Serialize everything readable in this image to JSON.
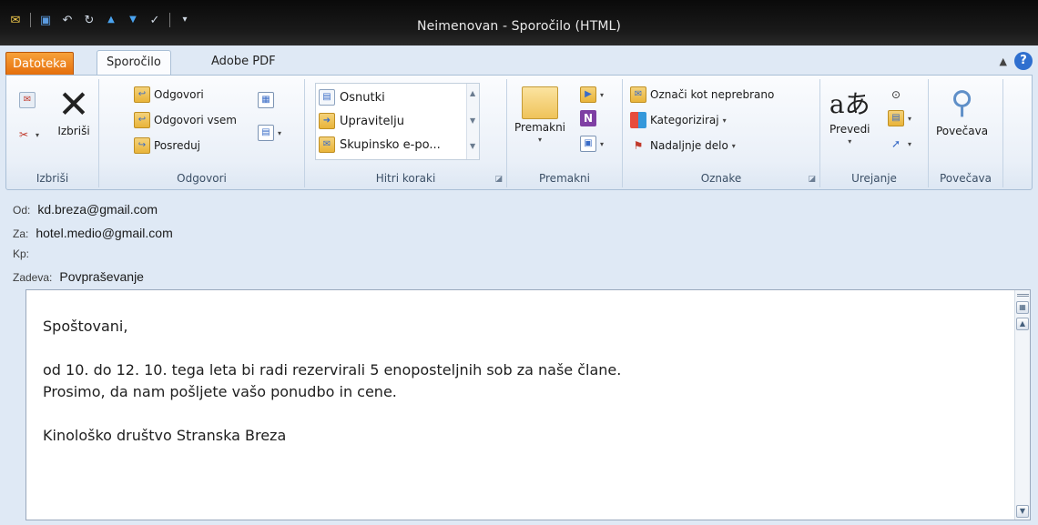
{
  "window": {
    "title": "Neimenovan  -  Sporočilo (HTML)"
  },
  "quick_access": [
    {
      "icon": "mail-icon",
      "glyph": "✉"
    },
    {
      "icon": "save-icon",
      "glyph": "■"
    },
    {
      "icon": "undo-icon",
      "glyph": "↶"
    },
    {
      "icon": "redo-icon",
      "glyph": "↻"
    },
    {
      "icon": "arrow-up-icon",
      "glyph": "▲"
    },
    {
      "icon": "arrow-down-icon",
      "glyph": "▼"
    },
    {
      "icon": "spelling-icon",
      "glyph": "✓"
    },
    {
      "icon": "customize-icon",
      "glyph": "▾"
    }
  ],
  "tabs": {
    "file": "Datoteka",
    "message": "Sporočilo",
    "adobe": "Adobe PDF"
  },
  "ribbon": {
    "delete_group": {
      "label": "Izbriši",
      "delete_button": "Izbriši"
    },
    "respond_group": {
      "label": "Odgovori",
      "reply": "Odgovori",
      "reply_all": "Odgovori vsem",
      "forward": "Posreduj"
    },
    "quick_steps_group": {
      "label": "Hitri koraki",
      "items": [
        "Osnutki",
        "Upravitelju",
        "Skupinsko e-po..."
      ]
    },
    "move_group": {
      "label": "Premakni",
      "move_button": "Premakni"
    },
    "tags_group": {
      "label": "Oznake",
      "mark_unread": "Označi kot neprebrano",
      "categorize": "Kategoriziraj",
      "follow_up": "Nadaljnje delo"
    },
    "editing_group": {
      "label": "Urejanje",
      "translate": "Prevedi"
    },
    "zoom_group": {
      "label": "Povečava",
      "zoom_button": "Povečava"
    }
  },
  "header": {
    "from_label": "Od:",
    "from_value": "kd.breza@gmail.com",
    "to_label": "Za:",
    "to_value": "hotel.medio@gmail.com",
    "cc_label": "Kp:",
    "cc_value": "",
    "subject_label": "Zadeva:",
    "subject_value": "Povpraševanje"
  },
  "body": {
    "greeting": "Spoštovani,",
    "line1": "od 10. do 12. 10. tega leta bi radi rezervirali 5 enoposteljnih sob za naše člane.",
    "line2": "Prosimo, da nam pošljete vašo ponudbo in cene.",
    "signature": "Kinološko društvo Stranska Breza"
  },
  "colors": {
    "file_tab": "#e56f0c",
    "ribbon_bg": "#eaf0f8",
    "title_bar": "#0a0a0a"
  }
}
